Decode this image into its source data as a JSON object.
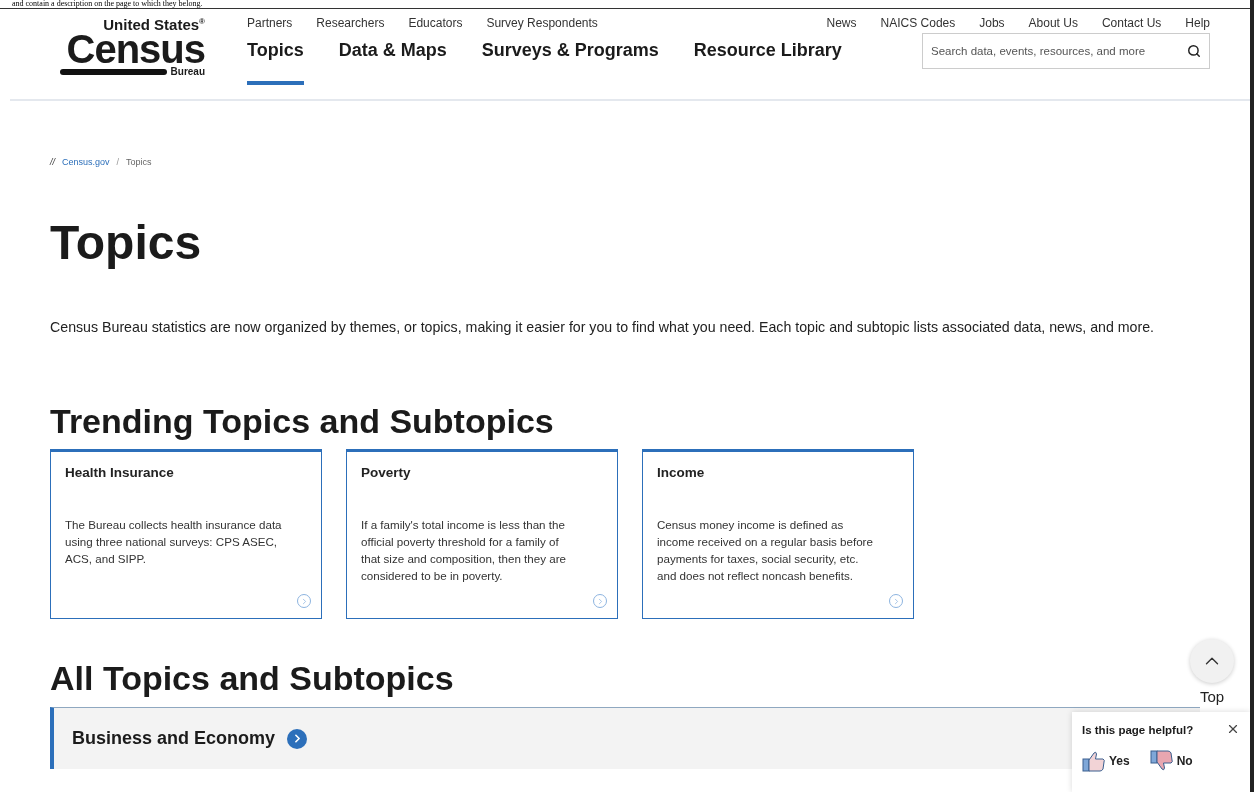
{
  "top_fragment": "and contain a description on the page to which they belong.",
  "logo": {
    "line1": "United States$^{®}$",
    "line2": "Census",
    "line3": "Bureau"
  },
  "utility_left": [
    "Partners",
    "Researchers",
    "Educators",
    "Survey Respondents"
  ],
  "utility_right": [
    "News",
    "NAICS Codes",
    "Jobs",
    "About Us",
    "Contact Us",
    "Help"
  ],
  "main_nav": [
    {
      "label": "Topics",
      "selected": true
    },
    {
      "label": "Data & Maps",
      "selected": false
    },
    {
      "label": "Surveys & Programs",
      "selected": false
    },
    {
      "label": "Resource Library",
      "selected": false
    }
  ],
  "search": {
    "placeholder": "Search data, events, resources, and more"
  },
  "breadcrumb": {
    "lead": "//",
    "divider": "/",
    "items": [
      {
        "label": "Census.gov",
        "kind": "link"
      },
      {
        "label": "Topics",
        "kind": "current"
      }
    ]
  },
  "title": "Topics",
  "intro": "Census Bureau statistics are now organized by themes, or topics, making it easier for you to find what you need. Each topic and subtopic lists associated data, news, and more.",
  "trending": {
    "heading": "Trending Topics and Subtopics",
    "cards": [
      {
        "title": "Health Insurance",
        "text": "The Bureau collects health insurance data using three national surveys: CPS ASEC, ACS, and SIPP."
      },
      {
        "title": "Poverty",
        "text": "If a family's total income is less than the official poverty threshold for a family of that size and composition, then they are considered to be in poverty."
      },
      {
        "title": "Income",
        "text": "Census money income is defined as income received on a regular basis before payments for taxes, social security, etc. and does not reflect noncash benefits."
      }
    ]
  },
  "all": {
    "heading": "All Topics and Subtopics",
    "items": [
      {
        "label": "Business and Economy"
      }
    ]
  },
  "top_button": {
    "label": "Top"
  },
  "feedback": {
    "question": "Is this page helpful?",
    "options": [
      {
        "label": "Yes",
        "kind": "up"
      },
      {
        "label": "No",
        "kind": "down"
      }
    ]
  }
}
